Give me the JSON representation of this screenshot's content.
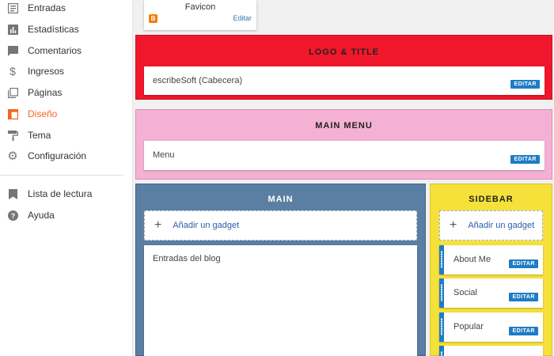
{
  "nav": {
    "items": [
      {
        "label": "Entradas",
        "icon": "posts-icon",
        "active": false
      },
      {
        "label": "Estadísticas",
        "icon": "stats-icon",
        "active": false
      },
      {
        "label": "Comentarios",
        "icon": "comments-icon",
        "active": false
      },
      {
        "label": "Ingresos",
        "icon": "dollar-icon",
        "active": false
      },
      {
        "label": "Páginas",
        "icon": "pages-icon",
        "active": false
      },
      {
        "label": "Diseño",
        "icon": "layout-icon",
        "active": true
      },
      {
        "label": "Tema",
        "icon": "paint-roller-icon",
        "active": false
      },
      {
        "label": "Configuración",
        "icon": "gear-icon",
        "active": false
      },
      {
        "label": "Lista de lectura",
        "icon": "bookmark-icon",
        "active": false
      },
      {
        "label": "Ayuda",
        "icon": "help-icon",
        "active": false
      }
    ],
    "active_color": "#f26522"
  },
  "favicon": {
    "title": "Favicon",
    "edit_label": "Editar",
    "blogger_glyph": "B"
  },
  "logo_section": {
    "title": "LOGO & TITLE",
    "widget_label": "escribeSoft (Cabecera)",
    "edit_label": "EDITAR",
    "color": "#f0172c"
  },
  "menu_section": {
    "title": "MAIN MENU",
    "widget_label": "Menu",
    "edit_label": "EDITAR",
    "color": "#f5b1d3"
  },
  "main_section": {
    "title": "MAIN",
    "add_gadget_label": "Añadir un gadget",
    "widget_label": "Entradas del blog",
    "color": "#5b7fa3"
  },
  "sidebar_section": {
    "title": "SIDEBAR",
    "add_gadget_label": "Añadir un gadget",
    "color": "#f6e13a",
    "widgets": [
      {
        "label": "About Me",
        "edit_label": "EDITAR"
      },
      {
        "label": "Social",
        "edit_label": "EDITAR"
      },
      {
        "label": "Popular",
        "edit_label": "EDITAR"
      }
    ]
  },
  "accent": "#1e7cc6"
}
